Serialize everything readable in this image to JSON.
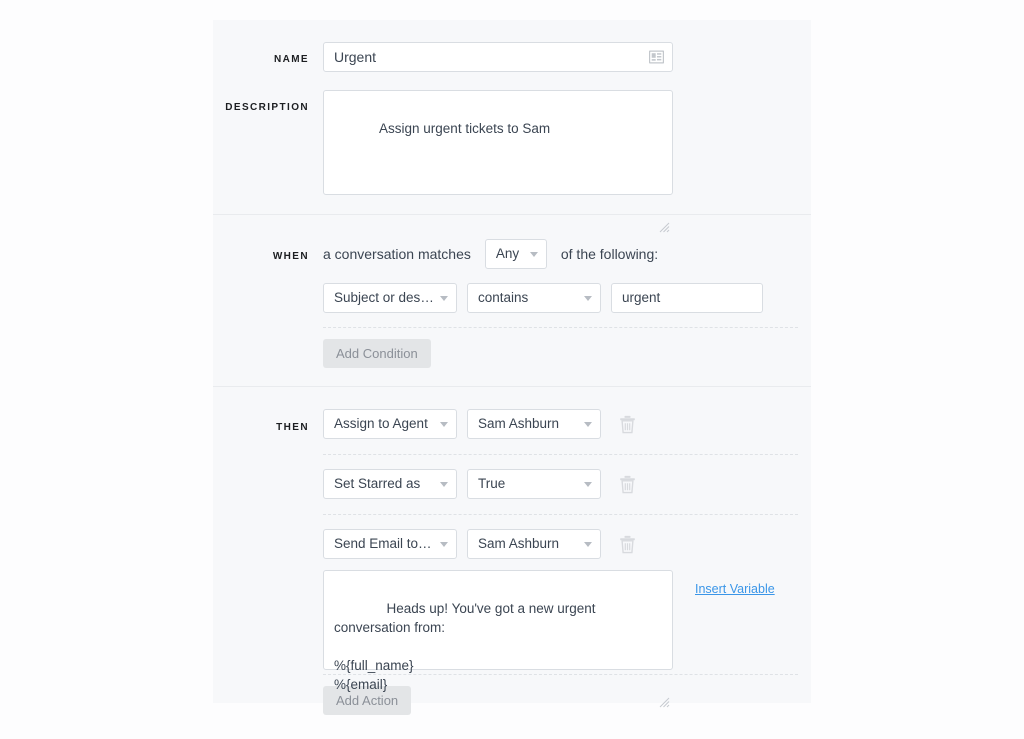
{
  "panel": {
    "background_color": "#f7f8fa",
    "page_background_color": "#fdfdfe",
    "accent_link_color": "#3b96e8"
  },
  "basic": {
    "name_label": "NAME",
    "name_value": "Urgent",
    "name_field_icon": "contact-card-icon",
    "description_label": "DESCRIPTION",
    "description_value": "Assign urgent tickets to Sam"
  },
  "when": {
    "label": "WHEN",
    "prefix_text": "a conversation matches",
    "match_type_value": "Any",
    "suffix_text": "of the following:",
    "conditions": [
      {
        "field_value": "Subject or desc...",
        "operator_value": "contains",
        "value": "urgent"
      }
    ],
    "add_condition_label": "Add Condition"
  },
  "then": {
    "label": "THEN",
    "actions": [
      {
        "action_value": "Assign to Agent",
        "target_value": "Sam Ashburn",
        "delete_icon": "trash-icon"
      },
      {
        "action_value": "Set Starred as",
        "target_value": "True",
        "delete_icon": "trash-icon"
      },
      {
        "action_value": "Send Email to A...",
        "target_value": "Sam Ashburn",
        "delete_icon": "trash-icon"
      }
    ],
    "email_body": "Heads up! You've got a new urgent conversation from:\n\n%{full_name}\n%{email}",
    "insert_variable_label": "Insert Variable",
    "add_action_label": "Add Action"
  }
}
